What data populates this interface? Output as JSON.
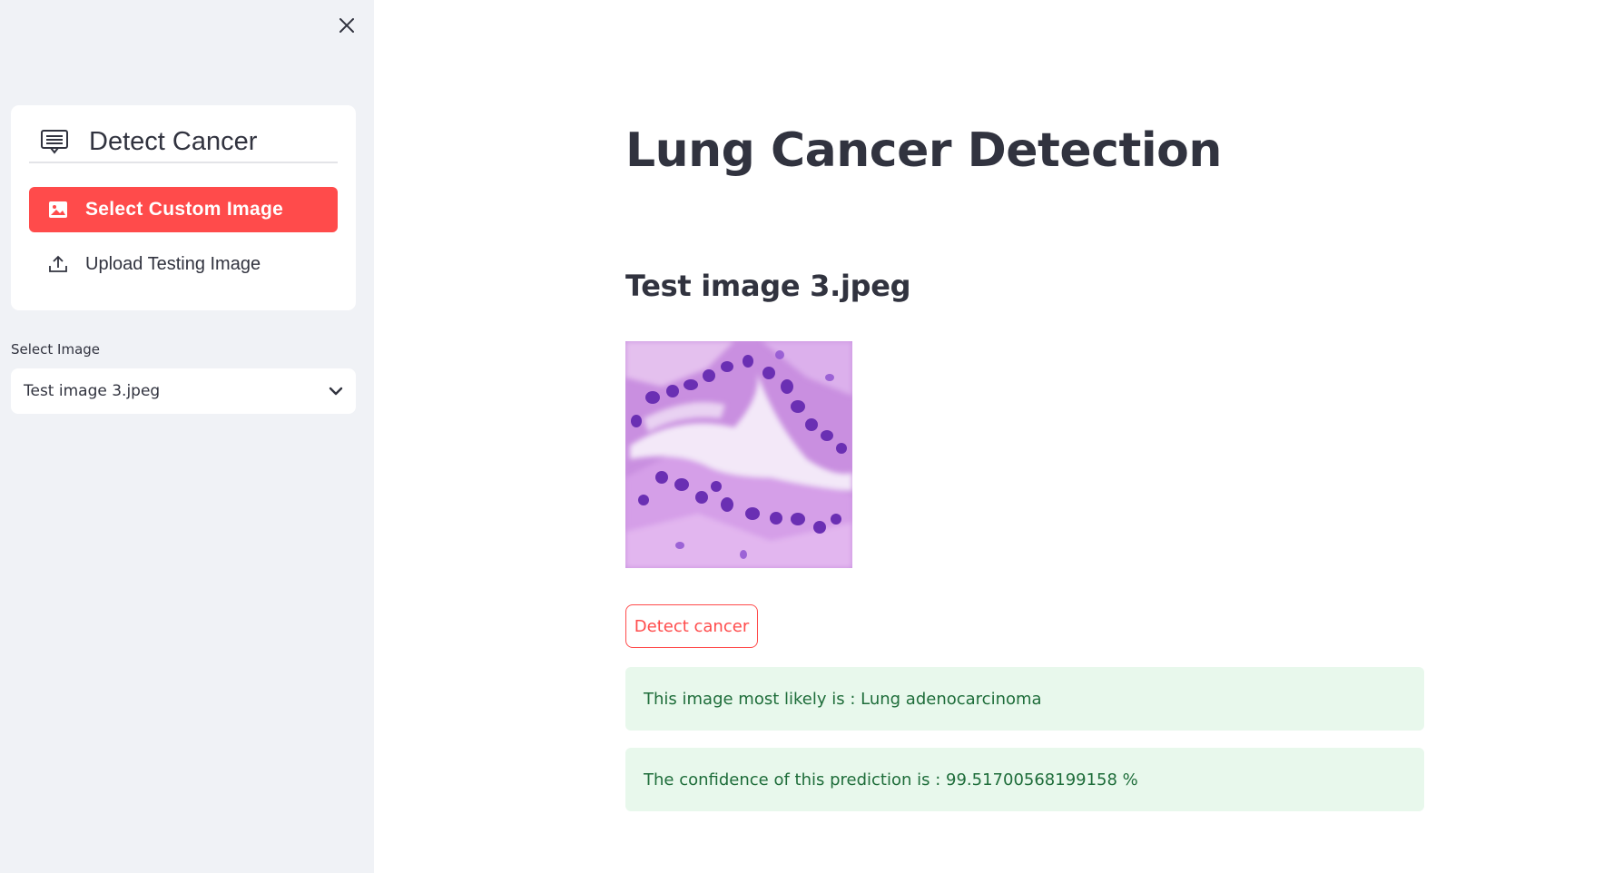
{
  "sidebar": {
    "close_label": "×",
    "menu": {
      "title": "Detect Cancer",
      "items": [
        {
          "label": "Select Custom Image",
          "icon": "image-icon",
          "active": true
        },
        {
          "label": "Upload Testing Image",
          "icon": "upload-icon",
          "active": false
        }
      ]
    },
    "select": {
      "label": "Select Image",
      "value": "Test image 3.jpeg"
    }
  },
  "main": {
    "title": "Lung Cancer Detection",
    "subtitle": "Test image 3.jpeg",
    "detect_button": "Detect cancer",
    "result_class": "This image most likely is : Lung adenocarcinoma",
    "result_confidence": "The confidence of this prediction is : 99.51700568199158 %"
  },
  "colors": {
    "accent": "#ff4b4b",
    "sidebar_bg": "#f0f2f6",
    "success_bg": "#e8f8ec",
    "success_text": "#1e6d3a",
    "text": "#31333f"
  }
}
